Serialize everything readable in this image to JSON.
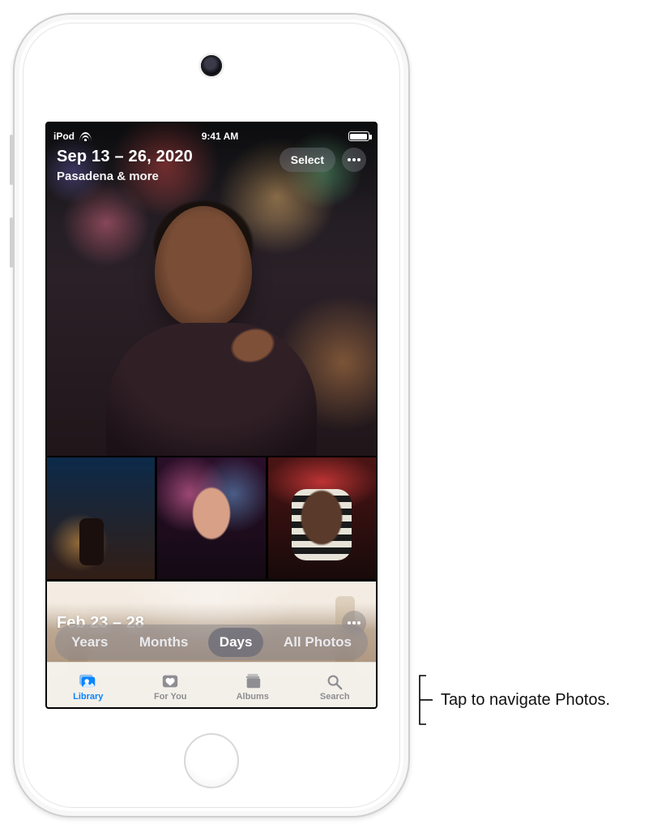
{
  "statusbar": {
    "device_label": "iPod",
    "time": "9:41 AM"
  },
  "sections": [
    {
      "date_range": "Sep 13 – 26, 2020",
      "location": "Pasadena & more",
      "select_label": "Select"
    },
    {
      "date_range": "Feb 23 – 28"
    }
  ],
  "view_switcher": {
    "options": [
      "Years",
      "Months",
      "Days",
      "All Photos"
    ],
    "active_index": 2
  },
  "tabs": {
    "items": [
      {
        "id": "library",
        "label": "Library"
      },
      {
        "id": "for_you",
        "label": "For You"
      },
      {
        "id": "albums",
        "label": "Albums"
      },
      {
        "id": "search",
        "label": "Search"
      }
    ],
    "active_index": 0
  },
  "callout": {
    "text": "Tap to navigate Photos."
  },
  "colors": {
    "accent": "#0a84ff",
    "inactive": "#8e8e93",
    "overlay_pill": "rgba(120,120,128,.42)"
  }
}
